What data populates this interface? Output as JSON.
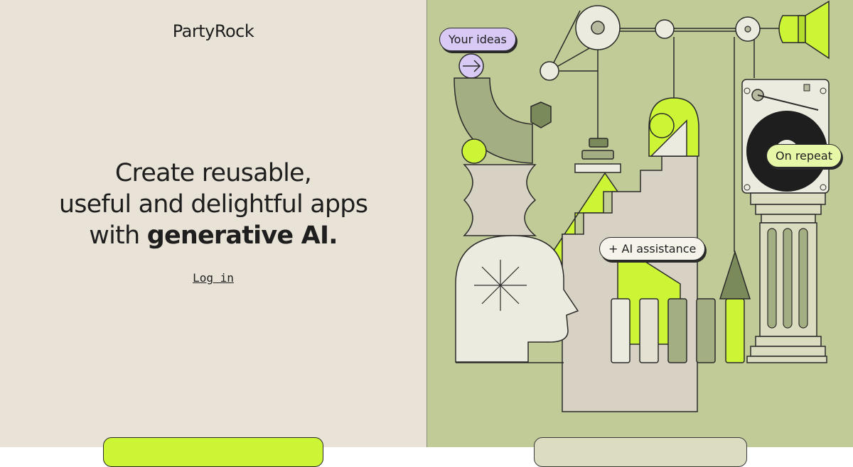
{
  "brand": {
    "name": "PartyRock"
  },
  "hero": {
    "line1": "Create reusable,",
    "line2": "useful and delightful apps",
    "line3_prefix": "with ",
    "line3_bold": "generative AI."
  },
  "auth": {
    "login_label": "Log in"
  },
  "illustration": {
    "tag_ideas": "Your ideas",
    "tag_ai": "+ AI assistance",
    "tag_repeat": "On repeat"
  },
  "colors": {
    "left_bg": "#e8e3d6",
    "right_bg": "#c0cb97",
    "accent_lime": "#ccf536",
    "accent_lavender": "#d9c9f5"
  }
}
